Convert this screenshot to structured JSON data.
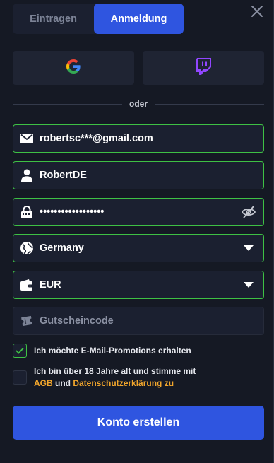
{
  "tabs": {
    "register_label": "Eintragen",
    "login_label": "Anmeldung"
  },
  "divider": {
    "text": "oder"
  },
  "fields": {
    "email": "robertsc***@gmail.com",
    "username": "RobertDE",
    "password": "••••••••••••••••••",
    "country": "Germany",
    "currency": "EUR",
    "coupon_placeholder": "Gutscheincode"
  },
  "checkboxes": {
    "promo": {
      "label": "Ich möchte E-Mail-Promotions erhalten",
      "checked": true
    },
    "terms": {
      "line1": "Ich bin über 18 Jahre alt und stimme mit",
      "agb": "AGB",
      "und": " und ",
      "privacy": "Datenschutzerklärung zu",
      "checked": false
    }
  },
  "submit": {
    "label": "Konto erstellen"
  },
  "colors": {
    "accent_blue": "#2f55e0",
    "valid_green": "#3ec144",
    "link_orange": "#f2a62c",
    "twitch_purple": "#9146ff"
  },
  "icons": [
    "close-icon",
    "google-icon",
    "twitch-icon",
    "envelope-icon",
    "user-icon",
    "lock-icon",
    "eye-slash-icon",
    "globe-icon",
    "chevron-down-icon",
    "wallet-icon",
    "ticket-icon",
    "check-icon"
  ]
}
